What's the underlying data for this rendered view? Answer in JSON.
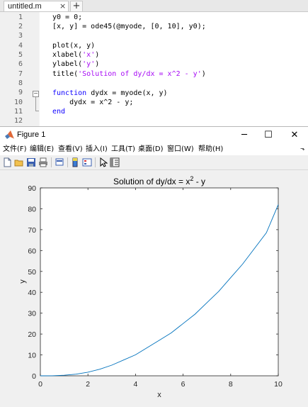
{
  "editor": {
    "tab_label": "untitled.m",
    "tab_close": "×",
    "tab_add": "+",
    "line_numbers": [
      "1",
      "2",
      "3",
      "4",
      "5",
      "6",
      "7",
      "8",
      "9",
      "10",
      "11",
      "12"
    ],
    "lines": {
      "l1": "y0 = 0;",
      "l2": "[x, y] = ode45(@myode, [0, 10], y0);",
      "l4": "plot(x, y)",
      "l5_pre": "xlabel(",
      "l5_str": "'x'",
      "l5_post": ")",
      "l6_pre": "ylabel(",
      "l6_str": "'y'",
      "l6_post": ")",
      "l7_pre": "title(",
      "l7_str": "'Solution of dy/dx = x^2 - y'",
      "l7_post": ")",
      "l9_kw": "function",
      "l9_rest": " dydx = myode(x, y)",
      "l10": "    dydx = x^2 - y;",
      "l11_kw": "end"
    },
    "fold_marker": "−"
  },
  "figure": {
    "title": "Figure 1",
    "controls": {
      "minimize": "─",
      "maximize": "☐",
      "close": "✕"
    },
    "menu": [
      "文件(F)",
      "编辑(E)",
      "查看(V)",
      "插入(I)",
      "工具(T)",
      "桌面(D)",
      "窗口(W)",
      "帮助(H)"
    ],
    "toolbar_icons": [
      "new-figure-icon",
      "open-file-icon",
      "save-icon",
      "print-icon",
      "print-preview-icon",
      "colorbar-icon",
      "legend-icon",
      "pointer-icon",
      "property-editor-icon"
    ]
  },
  "colors": {
    "line": "#0072bd",
    "keyword": "#0e00ff",
    "string": "#a709f5",
    "matlab_logo": "#e16737"
  },
  "chart_data": {
    "type": "line",
    "title_main": "Solution of dy/dx = x",
    "title_sup": "2",
    "title_tail": " - y",
    "xlabel": "x",
    "ylabel": "y",
    "xlim": [
      0,
      10
    ],
    "ylim": [
      0,
      90
    ],
    "xticks": [
      0,
      2,
      4,
      6,
      8,
      10
    ],
    "yticks": [
      0,
      10,
      20,
      30,
      40,
      50,
      60,
      70,
      80,
      90
    ],
    "grid": false,
    "series": [
      {
        "x": [
          0,
          0.5,
          1,
          1.5,
          2,
          2.5,
          3,
          3.5,
          4,
          4.5,
          5,
          5.5,
          6,
          6.5,
          7,
          7.5,
          8,
          8.5,
          9,
          9.5,
          10
        ],
        "values": [
          0,
          0.04,
          0.26,
          0.78,
          1.73,
          3.16,
          5.1,
          7.57,
          10.04,
          13.56,
          17.01,
          20.54,
          25.02,
          29.51,
          35.0,
          40.5,
          47.0,
          53.5,
          61.0,
          68.5,
          82.0
        ]
      }
    ]
  }
}
